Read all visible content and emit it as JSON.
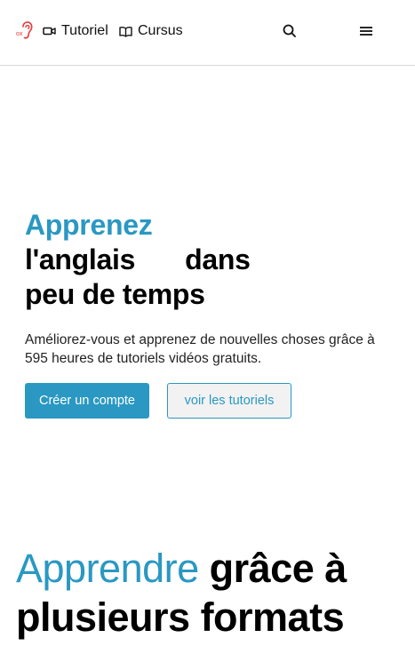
{
  "header": {
    "logo_icon": "ear-logo-icon",
    "nav": [
      {
        "label": "Tutoriel",
        "icon": "video-camera-icon"
      },
      {
        "label": "Cursus",
        "icon": "open-book-icon"
      }
    ],
    "search_icon": "search-icon",
    "menu_icon": "hamburger-menu-icon"
  },
  "hero": {
    "title_accent": "Apprenez",
    "title_line2_a": "l'anglais",
    "title_line2_b": "dans",
    "title_line3": "peu de temps",
    "subtitle": "Améliorez-vous et apprenez de nouvelles choses grâce à 595 heures de tutoriels vidéos gratuits.",
    "cta_primary": "Créer un compte",
    "cta_secondary": "voir les tutoriels"
  },
  "section": {
    "title_accent": "Apprendre",
    "title_rest": " grâce à plusieurs formats"
  },
  "colors": {
    "accent": "#2a98c2",
    "text": "#000000",
    "secondary_button_bg": "#f2f2f2"
  }
}
